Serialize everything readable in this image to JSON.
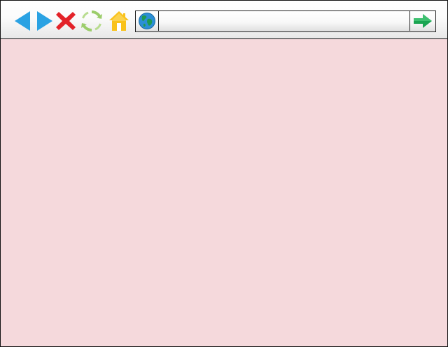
{
  "toolbar": {
    "buttons": [
      {
        "name": "back",
        "icon": "arrow-left-icon",
        "color": "#2aa2e3"
      },
      {
        "name": "forward",
        "icon": "arrow-right-icon",
        "color": "#2aa2e3"
      },
      {
        "name": "stop",
        "icon": "close-icon",
        "color": "#e32228"
      },
      {
        "name": "refresh",
        "icon": "refresh-icon",
        "color": "#9ccd6b"
      },
      {
        "name": "home",
        "icon": "home-icon",
        "color": "#f9c21b"
      }
    ]
  },
  "address_bar": {
    "site_icon": "globe-icon",
    "url_value": "",
    "go_icon": "arrow-right-icon",
    "go_color": "#1aa451"
  },
  "content": {
    "background_color": "#f5d9dc"
  }
}
